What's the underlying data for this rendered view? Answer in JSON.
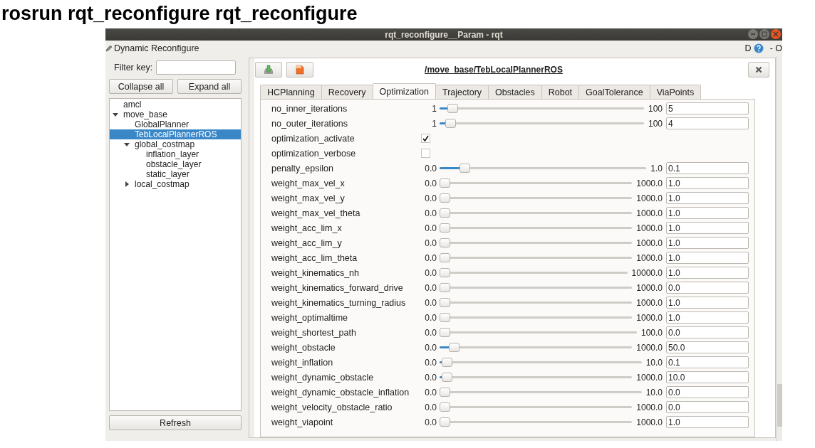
{
  "heading": "rosrun rqt_reconfigure rqt_reconfigure",
  "window": {
    "title": "rqt_reconfigure__Param - rqt"
  },
  "plugin_bar": {
    "title": "Dynamic Reconfigure",
    "help_label": "D",
    "right_label": "- O"
  },
  "sidebar": {
    "filter_label": "Filter key:",
    "buttons": [
      "Collapse all",
      "Expand all"
    ],
    "tree": [
      {
        "label": "amcl",
        "selected": false
      },
      {
        "label": "move_base",
        "selected": false,
        "expanded": true,
        "children": [
          {
            "label": "GlobalPlanner",
            "selected": false
          },
          {
            "label": "TebLocalPlannerROS",
            "selected": true
          },
          {
            "label": "global_costmap",
            "selected": false,
            "expanded": true,
            "children": [
              {
                "label": "inflation_layer",
                "selected": false
              },
              {
                "label": "obstacle_layer",
                "selected": false
              },
              {
                "label": "static_layer",
                "selected": false
              }
            ]
          },
          {
            "label": "local_costmap",
            "selected": false,
            "expanded": false
          }
        ]
      }
    ],
    "refresh": "Refresh"
  },
  "node": {
    "path": "/move_base/TebLocalPlannerROS"
  },
  "tabs": [
    {
      "label": "HCPlanning",
      "selected": false
    },
    {
      "label": "Recovery",
      "selected": false
    },
    {
      "label": "Optimization",
      "selected": true
    },
    {
      "label": "Trajectory",
      "selected": false
    },
    {
      "label": "Obstacles",
      "selected": false
    },
    {
      "label": "Robot",
      "selected": false
    },
    {
      "label": "GoalTolerance",
      "selected": false
    },
    {
      "label": "ViaPoints",
      "selected": false
    }
  ],
  "params": [
    {
      "kind": "slider",
      "name": "no_inner_iterations",
      "min": "1",
      "max": "100",
      "level": 0.04,
      "value": "5"
    },
    {
      "kind": "slider",
      "name": "no_outer_iterations",
      "min": "1",
      "max": "100",
      "level": 0.03,
      "value": "4"
    },
    {
      "kind": "checkbox",
      "name": "optimization_activate",
      "checked": true
    },
    {
      "kind": "checkbox",
      "name": "optimization_verbose",
      "checked": false
    },
    {
      "kind": "slider",
      "name": "penalty_epsilon",
      "min": "0.0",
      "max": "1.0",
      "level": 0.1,
      "value": "0.1"
    },
    {
      "kind": "slider",
      "name": "weight_max_vel_x",
      "min": "0.0",
      "max": "1000.0",
      "level": 0.001,
      "value": "1.0"
    },
    {
      "kind": "slider",
      "name": "weight_max_vel_y",
      "min": "0.0",
      "max": "1000.0",
      "level": 0.001,
      "value": "1.0"
    },
    {
      "kind": "slider",
      "name": "weight_max_vel_theta",
      "min": "0.0",
      "max": "1000.0",
      "level": 0.001,
      "value": "1.0"
    },
    {
      "kind": "slider",
      "name": "weight_acc_lim_x",
      "min": "0.0",
      "max": "1000.0",
      "level": 0.001,
      "value": "1.0"
    },
    {
      "kind": "slider",
      "name": "weight_acc_lim_y",
      "min": "0.0",
      "max": "1000.0",
      "level": 0.001,
      "value": "1.0"
    },
    {
      "kind": "slider",
      "name": "weight_acc_lim_theta",
      "min": "0.0",
      "max": "1000.0",
      "level": 0.001,
      "value": "1.0"
    },
    {
      "kind": "slider",
      "name": "weight_kinematics_nh",
      "min": "0.0",
      "max": "10000.0",
      "level": 0.0001,
      "value": "1.0"
    },
    {
      "kind": "slider",
      "name": "weight_kinematics_forward_drive",
      "min": "0.0",
      "max": "1000.0",
      "level": 0,
      "value": "0.0"
    },
    {
      "kind": "slider",
      "name": "weight_kinematics_turning_radius",
      "min": "0.0",
      "max": "1000.0",
      "level": 0.001,
      "value": "1.0"
    },
    {
      "kind": "slider",
      "name": "weight_optimaltime",
      "min": "0.0",
      "max": "1000.0",
      "level": 0.001,
      "value": "1.0"
    },
    {
      "kind": "slider",
      "name": "weight_shortest_path",
      "min": "0.0",
      "max": "100.0",
      "level": 0,
      "value": "0.0"
    },
    {
      "kind": "slider",
      "name": "weight_obstacle",
      "min": "0.0",
      "max": "1000.0",
      "level": 0.05,
      "value": "50.0"
    },
    {
      "kind": "slider",
      "name": "weight_inflation",
      "min": "0.0",
      "max": "10.0",
      "level": 0.01,
      "value": "0.1"
    },
    {
      "kind": "slider",
      "name": "weight_dynamic_obstacle",
      "min": "0.0",
      "max": "1000.0",
      "level": 0.01,
      "value": "10.0"
    },
    {
      "kind": "slider",
      "name": "weight_dynamic_obstacle_inflation",
      "min": "0.0",
      "max": "10.0",
      "level": 0,
      "value": "0.0"
    },
    {
      "kind": "slider",
      "name": "weight_velocity_obstacle_ratio",
      "min": "0.0",
      "max": "1000.0",
      "level": 0,
      "value": "0.0"
    },
    {
      "kind": "slider",
      "name": "weight_viapoint",
      "min": "0.0",
      "max": "1000.0",
      "level": 0.001,
      "value": "1.0"
    }
  ]
}
